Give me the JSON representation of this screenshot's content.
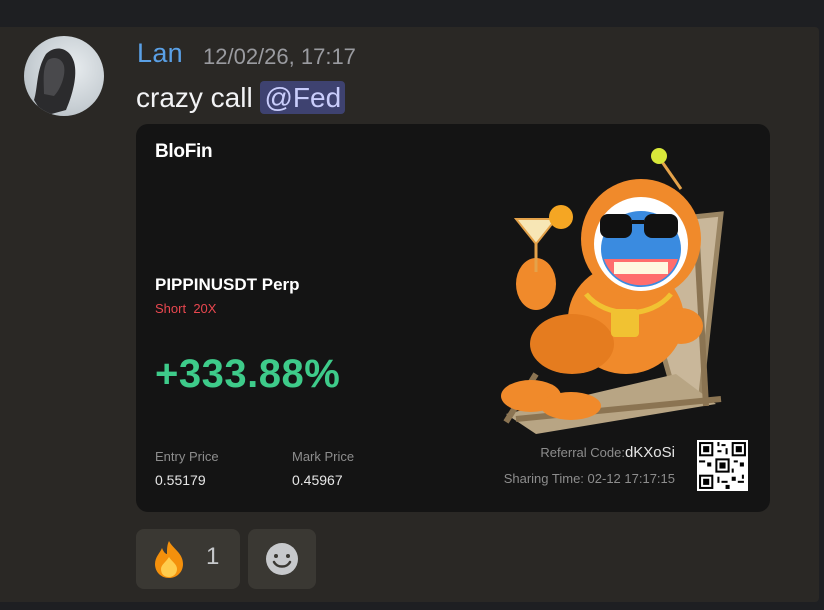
{
  "message": {
    "author": "Lan",
    "timestamp": "12/02/26, 17:17",
    "text": "crazy call",
    "mention": "@Fed",
    "avatar_icon": "avatar-photo"
  },
  "card": {
    "brand": "BloFin",
    "pair": "PIPPINUSDT Perp",
    "side": "Short",
    "leverage": "20X",
    "pnl": "+333.88%",
    "entry_label": "Entry Price",
    "entry_value": "0.55179",
    "mark_label": "Mark Price",
    "mark_value": "0.45967",
    "referral_label": "Referral Code:",
    "referral_code": "dKXoSi",
    "sharing_label": "Sharing Time:",
    "sharing_time": "02-12 17:17:15",
    "colors": {
      "positive": "#3ecb8a",
      "short": "#e8474f",
      "brand_accent": "#ff6a1a"
    }
  },
  "reactions": [
    {
      "emoji": "fire-emoji",
      "count": "1"
    },
    {
      "emoji": "add-reaction-icon",
      "count": ""
    }
  ],
  "colors": {
    "username": "#5aa0e6",
    "mention_bg": "#3e4270"
  }
}
